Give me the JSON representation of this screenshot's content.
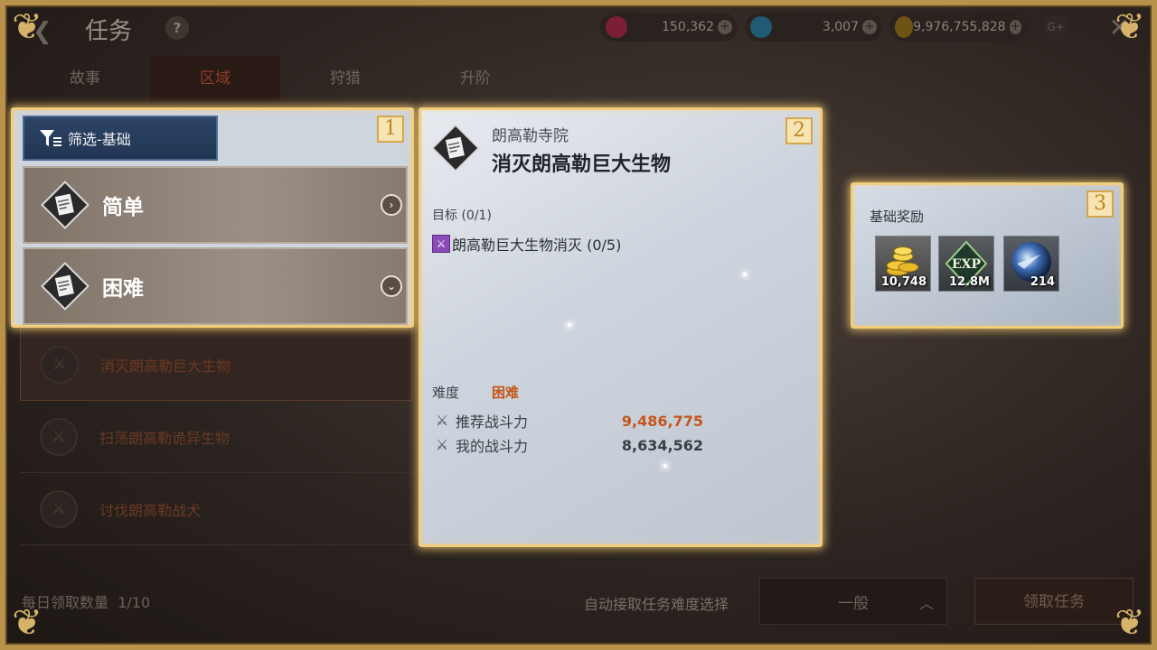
{
  "header": {
    "title": "任务",
    "help": "?",
    "currencies": [
      {
        "name": "ruby",
        "value": "150,362",
        "color": "#c0284a"
      },
      {
        "name": "diamond",
        "value": "3,007",
        "color": "#3fa6c8"
      },
      {
        "name": "gold",
        "value": "9,976,755,828",
        "color": "#c89a2a"
      }
    ],
    "gplus": "G+"
  },
  "tabs": [
    "故事",
    "区域",
    "狩猎",
    "升阶"
  ],
  "active_tab": "区域",
  "filter_panel": {
    "badge": "1",
    "filter_label": "筛选-基础",
    "options": [
      {
        "label": "简单"
      },
      {
        "label": "困难"
      }
    ]
  },
  "quest_list": [
    "消灭朗高勒巨大生物",
    "扫荡朗高勒诡异生物",
    "讨伐朗高勒战犬"
  ],
  "detail_panel": {
    "badge": "2",
    "location": "朗高勒寺院",
    "quest_name": "消灭朗高勒巨大生物",
    "goal_label": "目标 (0/1)",
    "objective": "朗高勒巨大生物消灭 (0/5)",
    "difficulty_label": "难度",
    "difficulty_value": "困难",
    "recommended_label": "推荐战斗力",
    "recommended_value": "9,486,775",
    "my_power_label": "我的战斗力",
    "my_power_value": "8,634,562"
  },
  "reward_panel": {
    "badge": "3",
    "title": "基础奖励",
    "rewards": [
      {
        "icon": "gold-coins-icon",
        "value": "10,748"
      },
      {
        "icon": "exp-icon",
        "value": "12.8M",
        "label": "EXP"
      },
      {
        "icon": "orb-icon",
        "value": "214"
      }
    ]
  },
  "footer": {
    "daily_label": "每日领取数量",
    "daily_value": "1/10",
    "auto_label": "自动接取任务难度选择",
    "auto_value": "一般",
    "accept_button": "领取任务"
  }
}
